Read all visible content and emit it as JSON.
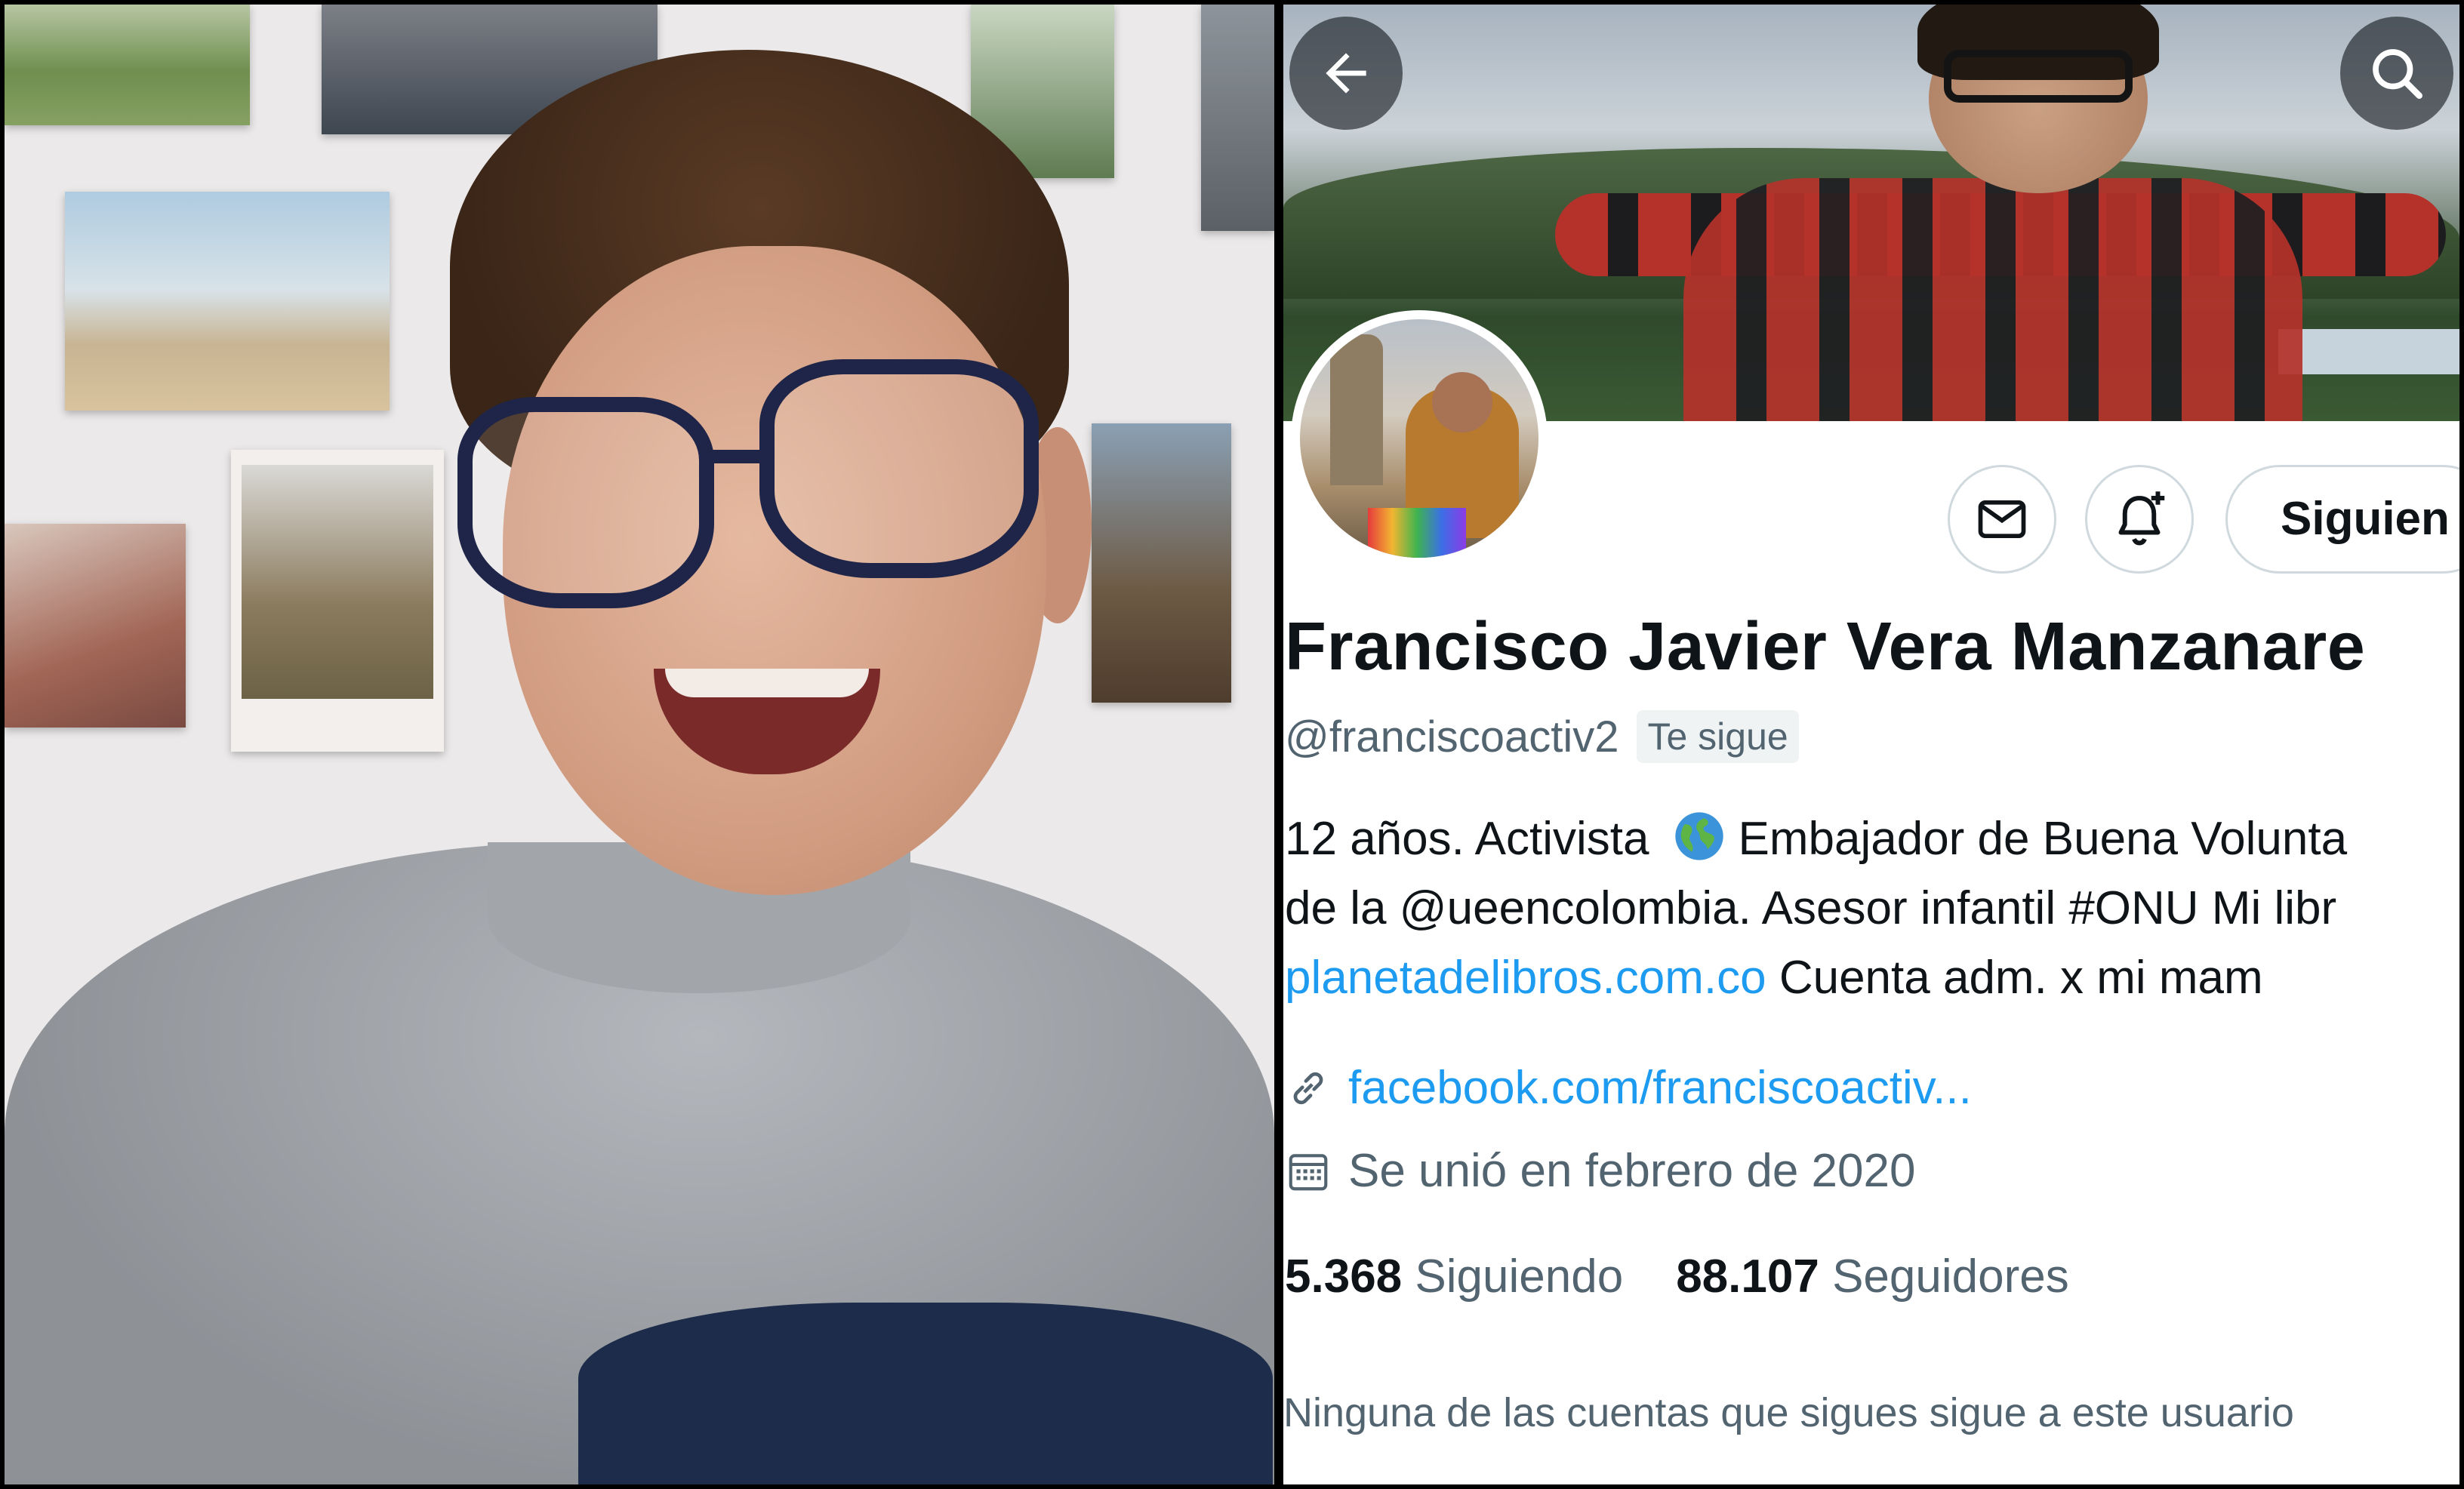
{
  "profile": {
    "display_name": "Francisco Javier Vera Manzanare",
    "handle": "@franciscoactiv2",
    "follows_you_badge": "Te sigue",
    "follow_button_label": "Siguien",
    "bio": {
      "line1_a": "12 años. Activista",
      "line1_b": "Embajador de Buena Volunta",
      "line2": "de la @ueencolombia. Asesor infantil #ONU Mi libr",
      "line3_link": "planetadelibros.com.co",
      "line3_rest": " Cuenta adm. x mi mam"
    },
    "website": "facebook.com/franciscoactiv...",
    "joined": "Se unió en febrero de 2020",
    "following_count": "5.368",
    "following_label": "Siguiendo",
    "followers_count": "88.107",
    "followers_label": "Seguidores",
    "mutuals_note": "Ninguna de las cuentas que sigues sigue a este usuario"
  },
  "icons": {
    "back": "arrow-left-icon",
    "search": "search-icon",
    "message": "envelope-icon",
    "notifications": "bell-plus-icon",
    "link": "link-icon",
    "calendar": "calendar-icon",
    "bio_emoji": "globe-icon"
  },
  "colors": {
    "link_blue": "#1d9bf0",
    "text_primary": "#0f1419",
    "text_secondary": "#536471"
  }
}
